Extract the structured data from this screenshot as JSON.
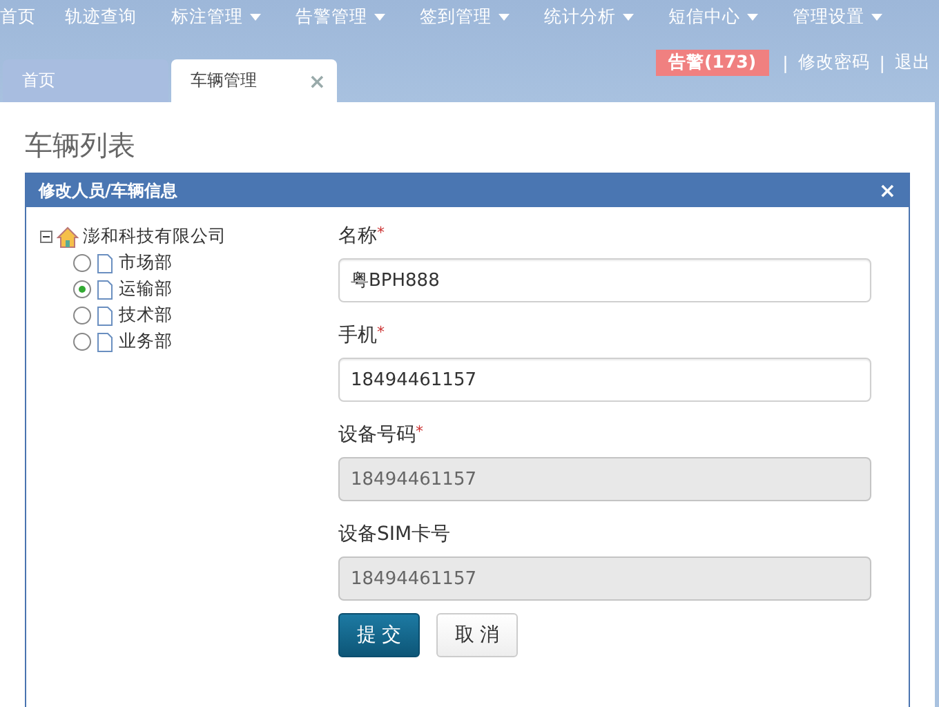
{
  "nav": [
    {
      "label": "首页",
      "dropdown": false
    },
    {
      "label": "轨迹查询",
      "dropdown": false
    },
    {
      "label": "标注管理",
      "dropdown": true
    },
    {
      "label": "告警管理",
      "dropdown": true
    },
    {
      "label": "签到管理",
      "dropdown": true
    },
    {
      "label": "统计分析",
      "dropdown": true
    },
    {
      "label": "短信中心",
      "dropdown": true
    },
    {
      "label": "管理设置",
      "dropdown": true
    }
  ],
  "tabs": [
    {
      "label": "首页",
      "selected": false,
      "closable": false
    },
    {
      "label": "车辆管理",
      "selected": true,
      "closable": true
    }
  ],
  "close_glyph": "×",
  "user_links": {
    "alarm": "告警(173)",
    "links": [
      "修改密码",
      "退出"
    ],
    "separator": "|"
  },
  "page_title": "车辆列表",
  "dialog": {
    "title": "修改人员/车辆信息",
    "close": "×",
    "tree": {
      "label": "澎和科技有限公司",
      "expanded": true,
      "children": [
        {
          "label": "市场部",
          "selected": false
        },
        {
          "label": "运输部",
          "selected": true
        },
        {
          "label": "技术部",
          "selected": false
        },
        {
          "label": "业务部",
          "selected": false
        }
      ]
    },
    "fields": [
      {
        "label": "名称",
        "required": true,
        "value": "粤BPH888",
        "disabled": false
      },
      {
        "label": "手机",
        "required": true,
        "value": "18494461157",
        "disabled": false
      },
      {
        "label": "设备号码",
        "required": true,
        "value": "18494461157",
        "disabled": true
      },
      {
        "label": "设备SIM卡号",
        "required": false,
        "value": "18494461157",
        "disabled": true
      }
    ],
    "required_mark": "*",
    "buttons": [
      {
        "label": "提 交",
        "kind": "primary"
      },
      {
        "label": "取 消",
        "kind": "default"
      }
    ]
  }
}
